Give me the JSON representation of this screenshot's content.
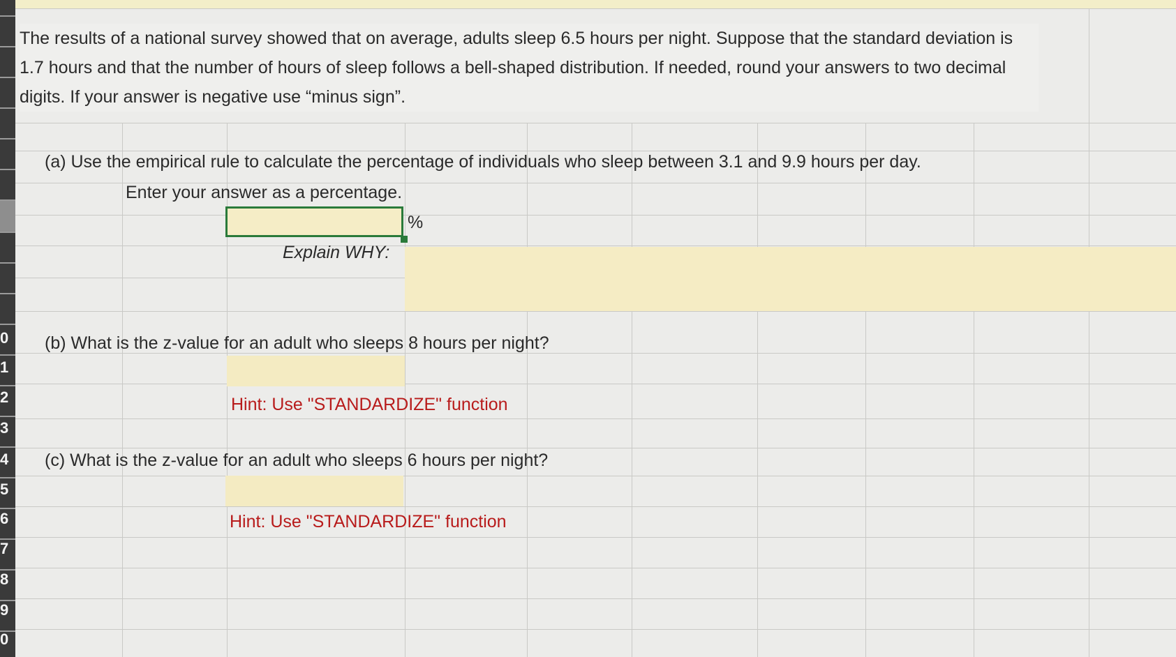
{
  "intro": {
    "text": "The results of a national survey showed that on average, adults sleep 6.5 hours per night. Suppose that the standard deviation is 1.7 hours and that the number of hours of sleep follows a bell-shaped distribution. If needed, round your answers to two decimal digits. If your answer is negative use “minus sign”."
  },
  "part_a": {
    "question": "(a) Use the empirical rule to calculate the percentage of individuals who sleep between 3.1 and 9.9 hours per day.",
    "instruction": "Enter your answer as a percentage.",
    "answer_value": "",
    "unit": "%",
    "explain_label": "Explain WHY:",
    "explain_value": ""
  },
  "part_b": {
    "question": "(b) What is the z-value for an adult who sleeps 8 hours per night?",
    "answer_value": "",
    "hint": "Hint: Use \"STANDARDIZE\" function"
  },
  "part_c": {
    "question": "(c) What is the z-value for an adult who sleeps 6 hours per night?",
    "answer_value": "",
    "hint": "Hint: Use \"STANDARDIZE\" function"
  },
  "row_headers": [
    "0",
    "1",
    "2",
    "3",
    "4",
    "5",
    "6",
    "7",
    "8",
    "9",
    "0"
  ],
  "colors": {
    "answer_fill": "#f4ebc2",
    "hint_text": "#b81b1b",
    "selection_border": "#2a7a3a"
  }
}
